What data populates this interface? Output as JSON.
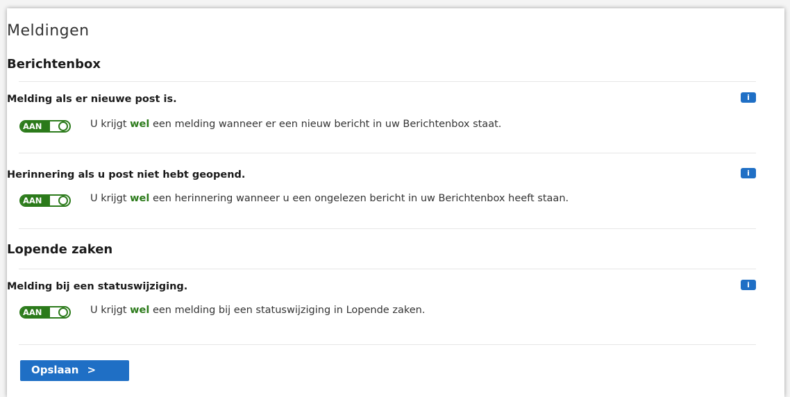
{
  "page": {
    "title": "Meldingen"
  },
  "sections": [
    {
      "title": "Berichtenbox",
      "settings": [
        {
          "title": "Melding als er nieuwe post is.",
          "toggle": "AAN",
          "desc_pre": "U krijgt ",
          "desc_hl": "wel",
          "desc_post": " een melding wanneer er een nieuw bericht in uw Berichtenbox staat.",
          "info": "i"
        },
        {
          "title": "Herinnering als u post niet hebt geopend.",
          "toggle": "AAN",
          "desc_pre": "U krijgt ",
          "desc_hl": "wel",
          "desc_post": " een herinnering wanneer u een ongelezen bericht in uw Berichtenbox heeft staan.",
          "info": "i"
        }
      ]
    },
    {
      "title": "Lopende zaken",
      "settings": [
        {
          "title": "Melding bij een statuswijziging.",
          "toggle": "AAN",
          "desc_pre": "U krijgt ",
          "desc_hl": "wel",
          "desc_post": " een melding bij een statuswijziging in Lopende zaken.",
          "info": "i"
        }
      ]
    }
  ],
  "actions": {
    "save_label": "Opslaan",
    "save_chevron": ">"
  },
  "colors": {
    "primary": "#1f6fc5",
    "toggle_on": "#2b7a1a",
    "highlight": "#2b7a1a"
  }
}
